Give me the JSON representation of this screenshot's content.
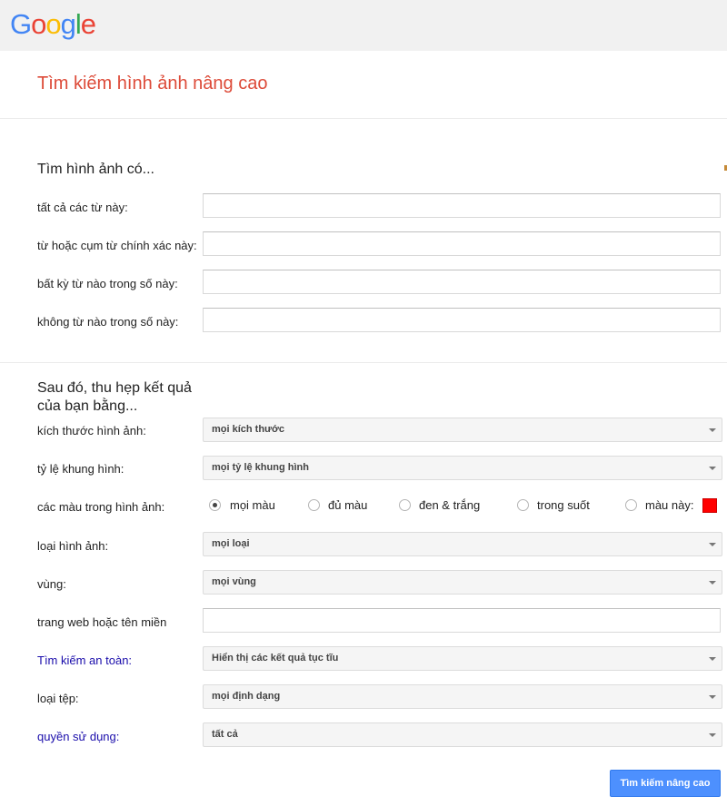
{
  "brand": {
    "logo_letters": [
      "G",
      "o",
      "o",
      "g",
      "l",
      "e"
    ],
    "logo_colors": [
      "#4285f4",
      "#ea4335",
      "#fbbc05",
      "#4285f4",
      "#34a853",
      "#ea4335"
    ]
  },
  "page": {
    "title": "Tìm kiếm hình ảnh nâng cao"
  },
  "find_section": {
    "heading": "Tìm hình ảnh có...",
    "fields": [
      {
        "label": "tất cả các từ này:",
        "value": ""
      },
      {
        "label": "từ hoặc cụm từ chính xác này:",
        "value": ""
      },
      {
        "label": "bất kỳ từ nào trong số này:",
        "value": ""
      },
      {
        "label": "không từ nào trong số này:",
        "value": ""
      }
    ]
  },
  "narrow_section": {
    "heading_line1": "Sau đó, thu hẹp kết quả",
    "heading_line2": "của bạn bằng...",
    "image_size": {
      "label": "kích thước hình ảnh:",
      "value": "mọi kích thước"
    },
    "aspect_ratio": {
      "label": "tỷ lệ khung hình:",
      "value": "mọi tỷ lệ khung hình"
    },
    "colors": {
      "label": "các màu trong hình ảnh:",
      "options": [
        "mọi màu",
        "đủ màu",
        "đen & trắng",
        "trong suốt",
        "màu này:"
      ],
      "selected": "mọi màu",
      "swatch_color": "#ff0000"
    },
    "image_type": {
      "label": "loại hình ảnh:",
      "value": "mọi loại"
    },
    "region": {
      "label": "vùng:",
      "value": "mọi vùng"
    },
    "site": {
      "label": "trang web hoặc tên miền",
      "value": ""
    },
    "safe_search": {
      "label": "Tìm kiếm an toàn:",
      "value": "Hiển thị các kết quả tục tĩu"
    },
    "file_type": {
      "label": "loại tệp:",
      "value": "mọi định dạng"
    },
    "usage_rights": {
      "label": "quyền sử dụng:",
      "value": "tất cả"
    }
  },
  "submit": {
    "label": "Tìm kiếm nâng cao"
  },
  "colors": {
    "title_red": "#dd4b39",
    "link_blue": "#1a0dab",
    "button_blue": "#4d90fe"
  }
}
